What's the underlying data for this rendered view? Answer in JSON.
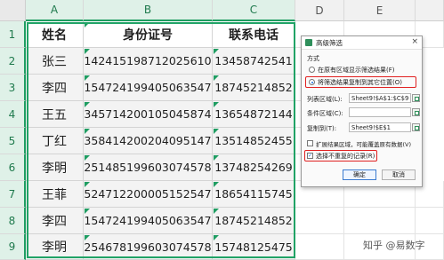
{
  "columns": [
    "A",
    "B",
    "C",
    "D",
    "E"
  ],
  "rows": [
    "1",
    "2",
    "3",
    "4",
    "5",
    "6",
    "7",
    "8",
    "9"
  ],
  "table": {
    "headers": [
      "姓名",
      "身份证号",
      "联系电话"
    ],
    "rows": [
      [
        "张三",
        "142415198712025610",
        "13458742541"
      ],
      [
        "李四",
        "154724199405063547",
        "18745214852"
      ],
      [
        "王五",
        "345714200105045874",
        "13654872144"
      ],
      [
        "丁红",
        "358414200204095147",
        "13514852455"
      ],
      [
        "李明",
        "251485199603074578",
        "13748254269"
      ],
      [
        "王菲",
        "524712200005152547",
        "18654115745"
      ],
      [
        "李四",
        "154724199405063547",
        "18745214852"
      ],
      [
        "李明",
        "254678199603074578",
        "15748125475"
      ]
    ]
  },
  "dialog": {
    "title": "高级筛选",
    "close": "×",
    "method_label": "方式",
    "option1": "在原有区域显示筛选结果(F)",
    "option2": "将筛选结果复制到其它位置(O)",
    "list_range_label": "列表区域(L):",
    "list_range_value": "Sheet9!$A$1:$C$9",
    "criteria_range_label": "条件区域(C):",
    "criteria_range_value": "",
    "copy_to_label": "复制到(T):",
    "copy_to_value": "Sheet9!$E$1",
    "extend_label": "扩展结果区域，可能覆盖原有数据(V)",
    "unique_label": "选择不重复的记录(R)",
    "ok_label": "确定",
    "cancel_label": "取消"
  },
  "watermark": "知乎 @易数字",
  "colors": {
    "accent": "#21a366",
    "highlight": "#e02020"
  }
}
